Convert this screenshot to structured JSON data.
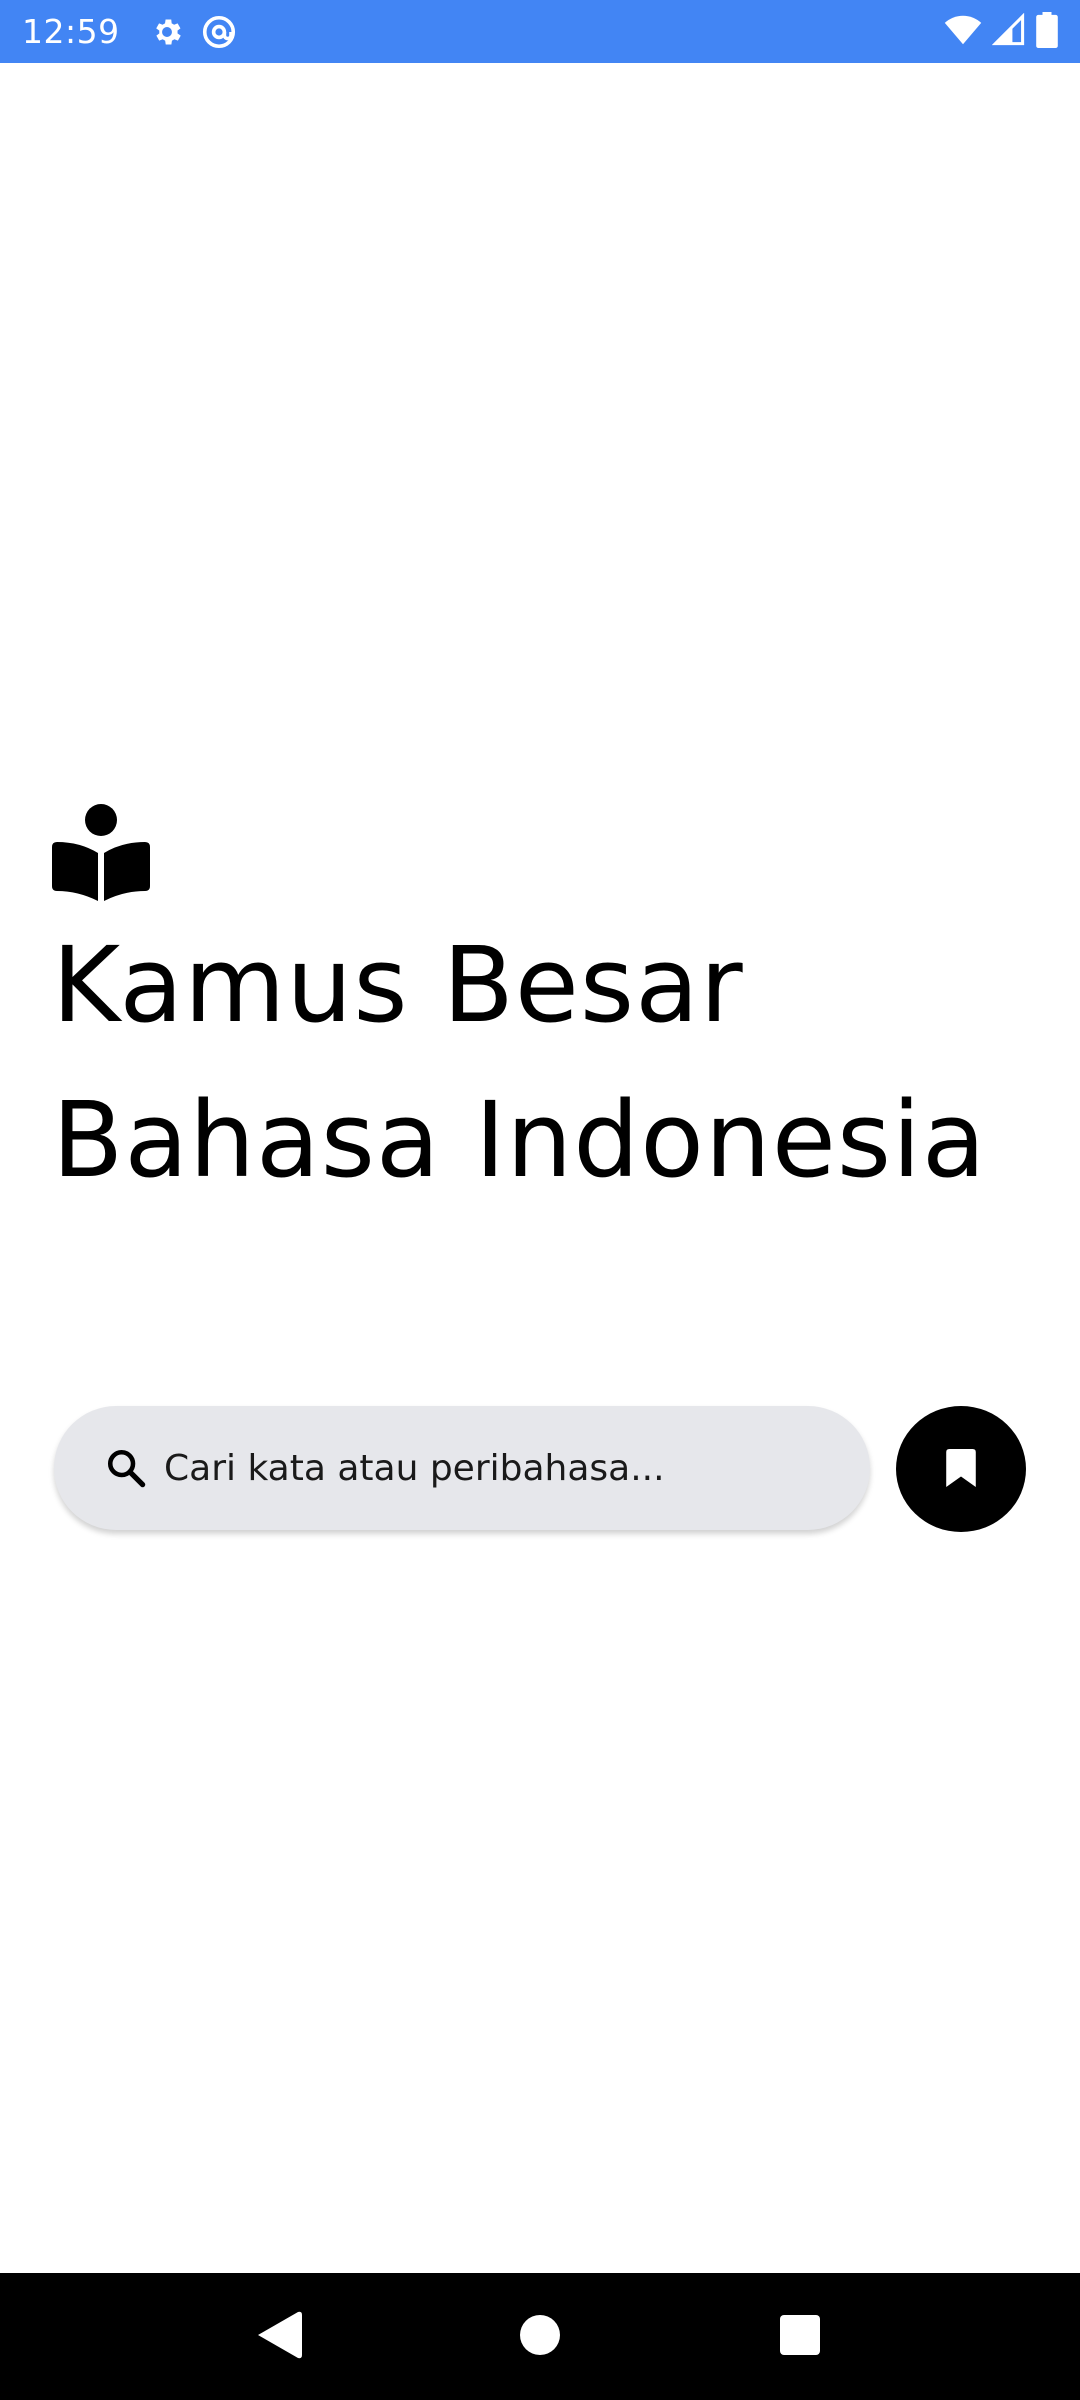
{
  "status_bar": {
    "time": "12:59",
    "left_icons": [
      "gear-icon",
      "at-sign-icon"
    ],
    "right_icons": [
      "wifi-icon",
      "signal-icon",
      "battery-icon"
    ],
    "background_color": "#4285f4"
  },
  "header": {
    "title": "Kamus Besar Bahasa Indonesia",
    "icon": "open-book-reader-icon"
  },
  "search": {
    "placeholder": "Cari kata atau peribahasa...",
    "value": "",
    "icon": "search-icon",
    "background_color": "#e6e7eb"
  },
  "bookmark_button": {
    "icon": "bookmark-icon",
    "background_color": "#000000"
  },
  "nav_bar": {
    "buttons": [
      "back-icon",
      "home-icon",
      "recents-icon"
    ]
  }
}
